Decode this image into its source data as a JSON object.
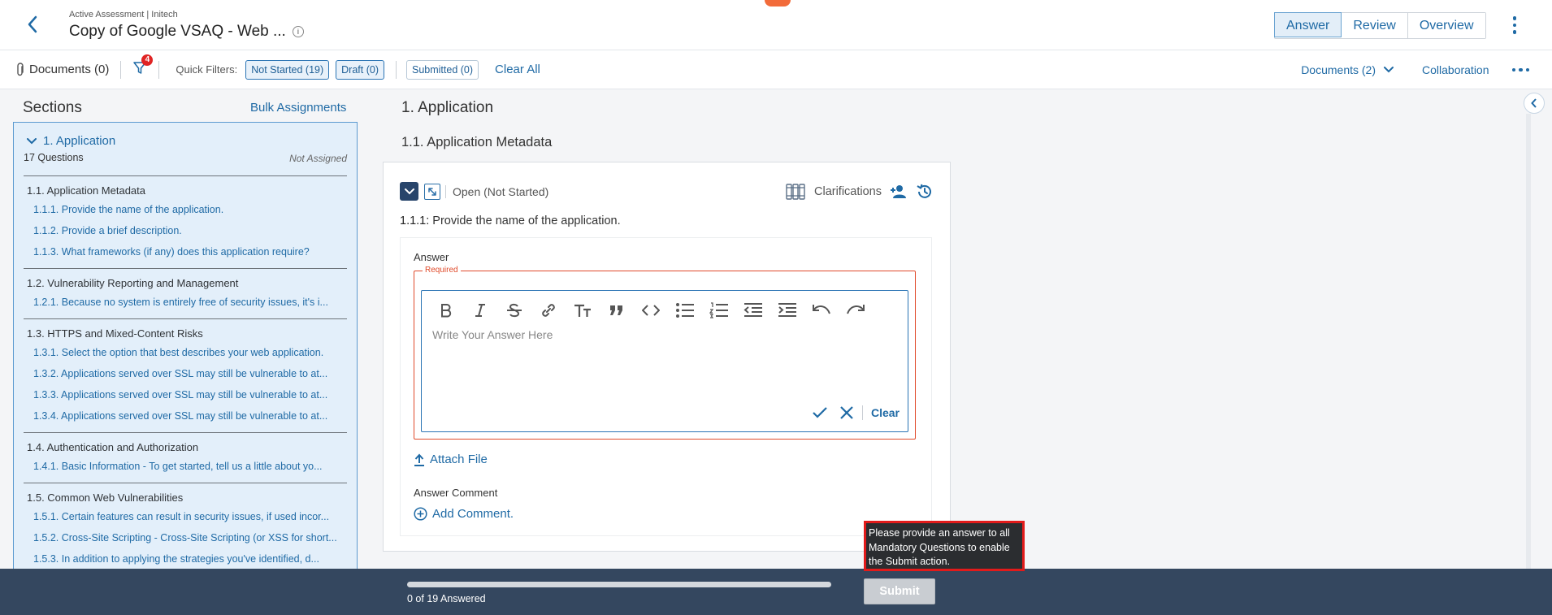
{
  "header": {
    "breadcrumb": "Active Assessment | Initech",
    "title": "Copy of Google VSAQ - Web ...",
    "tabs": [
      {
        "label": "Answer",
        "active": true
      },
      {
        "label": "Review",
        "active": false
      },
      {
        "label": "Overview",
        "active": false
      }
    ]
  },
  "filterbar": {
    "documents_label": "Documents (0)",
    "filter_badge": "4",
    "quick_filters_label": "Quick Filters:",
    "chips": [
      "Not Started (19)",
      "Draft (0)",
      "Submitted (0)"
    ],
    "clear_all": "Clear All",
    "documents_menu": "Documents (2)",
    "collaboration": "Collaboration"
  },
  "sidebar": {
    "title": "Sections",
    "bulk_label": "Bulk Assignments",
    "section_title": "1. Application",
    "question_count": "17 Questions",
    "assignment_status": "Not Assigned",
    "groups": [
      {
        "title": "1.1. Application Metadata",
        "items": [
          "1.1.1. Provide the name of the application.",
          "1.1.2. Provide a brief description.",
          "1.1.3. What frameworks (if any) does this application require?"
        ]
      },
      {
        "title": "1.2. Vulnerability Reporting and Management",
        "items": [
          "1.2.1. Because no system is entirely free of security issues, it's i..."
        ]
      },
      {
        "title": "1.3. HTTPS and Mixed-Content Risks",
        "items": [
          "1.3.1. Select the option that best describes your web application.",
          "1.3.2. Applications served over SSL may still be vulnerable to at...",
          "1.3.3. Applications served over SSL may still be vulnerable to at...",
          "1.3.4. Applications served over SSL may still be vulnerable to at..."
        ]
      },
      {
        "title": "1.4. Authentication and Authorization",
        "items": [
          "1.4.1. Basic Information - To get started, tell us a little about yo..."
        ]
      },
      {
        "title": "1.5. Common Web Vulnerabilities",
        "items": [
          "1.5.1. Certain features can result in security issues, if used incor...",
          "1.5.2. Cross-Site Scripting - Cross-Site Scripting (or XSS for short...",
          "1.5.3. In addition to applying the strategies you've identified, d..."
        ]
      }
    ]
  },
  "main": {
    "section_heading": "1. Application",
    "subsection_heading": "1.1. Application Metadata",
    "status": "Open (Not Started)",
    "clarifications": "Clarifications",
    "question_number": "1.1.1:",
    "question_text": " Provide the name of the application.",
    "answer_label": "Answer",
    "required_tag": "Required",
    "placeholder": "Write Your Answer Here",
    "clear_label": "Clear",
    "attach_label": "Attach File",
    "comment_label": "Answer Comment",
    "add_comment_label": "Add Comment."
  },
  "footer": {
    "progress_text": "0 of 19 Answered",
    "progress_fraction": 0.0,
    "submit_label": "Submit",
    "tooltip": "Please provide an answer to all Mandatory Questions to enable the Submit action."
  },
  "colors": {
    "accent": "#1f6aa5",
    "footer_bg": "#34475f",
    "required": "#e04a2a",
    "tooltip_border": "#e21b1b"
  }
}
